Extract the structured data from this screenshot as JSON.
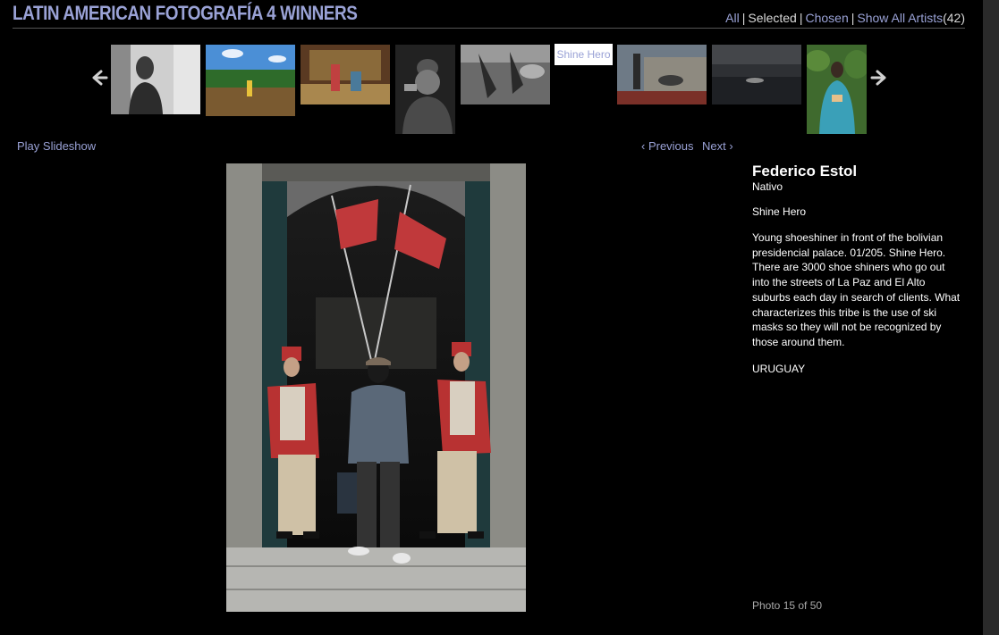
{
  "header": {
    "title": "LATIN AMERICAN FOTOGRAFÍA 4 WINNERS",
    "filters": {
      "all": "All",
      "sep": "|",
      "selected": "Selected",
      "chosen": "Chosen",
      "show_all_artists": "Show All Artists",
      "artist_count": "(42)"
    }
  },
  "filmstrip": {
    "prev_icon": "left-arrow-icon",
    "next_icon": "right-arrow-icon",
    "current_thumb_label": "Shine Hero"
  },
  "nav": {
    "play_slideshow": "Play Slideshow",
    "previous": "‹ Previous",
    "next": "Next ›"
  },
  "photo_info": {
    "artist": "Federico Estol",
    "series": "Nativo",
    "title": "Shine Hero",
    "description": "Young shoeshiner in front of the bolivian presidencial palace. 01/205. Shine Hero. There are 3000 shoe shiners who go out into the streets of La Paz and El Alto suburbs each day in search of clients. What characterizes this tribe is the use of ski masks so they will not be recognized by those around them.",
    "country": "URUGUAY",
    "counter": "Photo 15 of 50"
  },
  "colors": {
    "background": "#000000",
    "link": "#9aa2d6",
    "text": "#ffffff",
    "muted": "#a9a9a9"
  }
}
